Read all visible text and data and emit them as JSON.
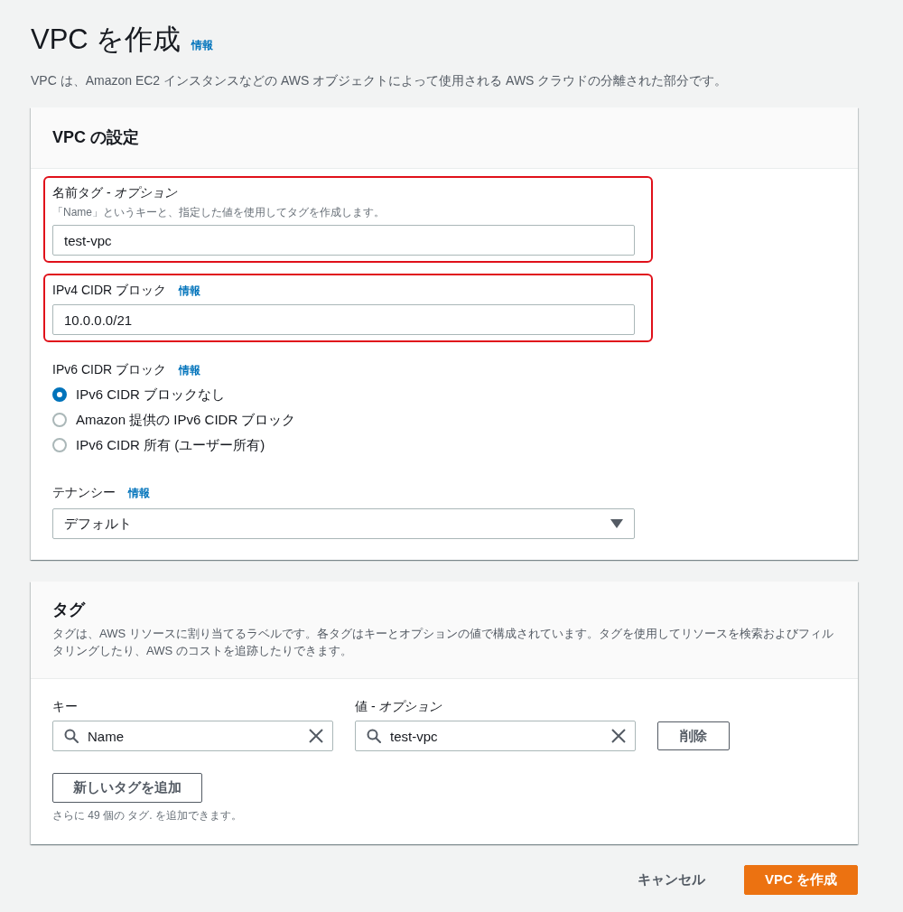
{
  "header": {
    "title": "VPC を作成",
    "info_link": "情報",
    "description": "VPC は、Amazon EC2 インスタンスなどの AWS オブジェクトによって使用される AWS クラウドの分離された部分です。"
  },
  "vpc_settings": {
    "title": "VPC の設定",
    "fields": [
      {
        "kind": "text",
        "label": "名前タグ - *オプション*",
        "hint": "「Name」というキーと、指定した値を使用してタグを作成します。",
        "value": "test-vpc",
        "highlighted": true
      },
      {
        "kind": "text",
        "label": "IPv4 CIDR ブロック",
        "info_link": "情報",
        "value": "10.0.0.0/21",
        "highlighted": true
      },
      {
        "kind": "radio",
        "label": "IPv6 CIDR ブロック",
        "info_link": "情報",
        "options": [
          {
            "label": "IPv6 CIDR ブロックなし",
            "selected": true
          },
          {
            "label": "Amazon 提供の IPv6 CIDR ブロック",
            "selected": false
          },
          {
            "label": "IPv6 CIDR 所有 (ユーザー所有)",
            "selected": false
          }
        ],
        "highlighted": false
      },
      {
        "kind": "select",
        "label": "テナンシー",
        "info_link": "情報",
        "value": "デフォルト",
        "highlighted": false
      }
    ]
  },
  "tags": {
    "title": "タグ",
    "description": "タグは、AWS リソースに割り当てるラベルです。各タグはキーとオプションの値で構成されています。タグを使用してリソースを検索およびフィルタリングしたり、AWS のコストを追跡したりできます。",
    "key_label": "キー",
    "value_label": "値 - *オプション*",
    "rows": [
      {
        "key": "Name",
        "value": "test-vpc",
        "remove_button": "削除"
      }
    ],
    "add_button": "新しいタグを追加",
    "note": "さらに 49 個の タグ. を追加できます。"
  },
  "actions": [
    {
      "kind": "link",
      "label": "キャンセル"
    },
    {
      "kind": "primary",
      "label": "VPC を作成"
    }
  ]
}
